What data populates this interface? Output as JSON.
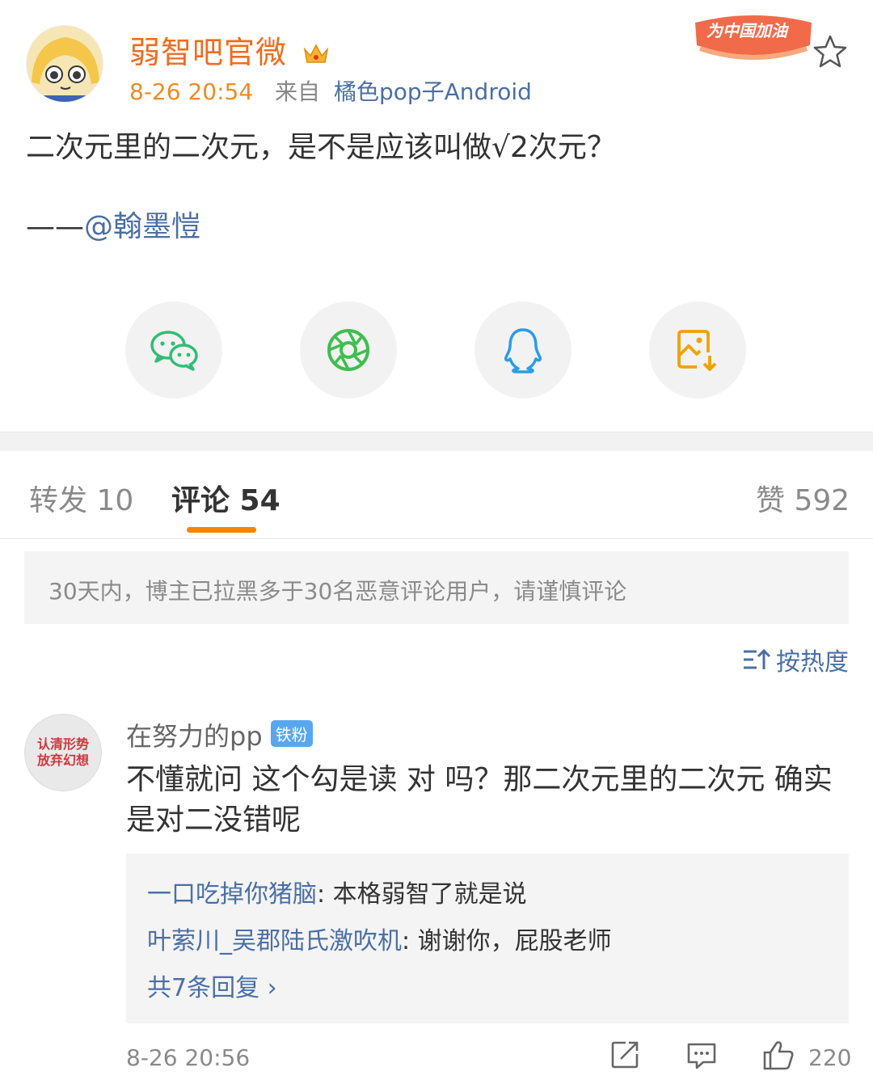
{
  "post": {
    "author": "弱智吧官微",
    "time": "8-26 20:54",
    "from_label": "来自",
    "device": "橘色pop子Android",
    "badge_text": "为中国加油",
    "text": "二次元里的二次元，是不是应该叫做√2次元？",
    "signature_prefix": "——",
    "signature_mention": "@翰墨愷"
  },
  "share": [
    "wechat-icon",
    "moments-icon",
    "qq-icon",
    "save-image-icon"
  ],
  "tabs": {
    "repost": "转发 10",
    "comment": "评论 54",
    "like": "赞 592"
  },
  "notice": "30天内，博主已拉黑多于30名恶意评论用户，请谨慎评论",
  "sort_label": "按热度",
  "comment": {
    "avatar_text_1": "认清形势",
    "avatar_text_2": "放弃幻想",
    "user": "在努力的pp",
    "tag": "铁粉",
    "text": "不懂就问 这个勾是读 对 吗？那二次元里的二次元 确实是对二没错呢",
    "replies": [
      {
        "name": "一口吃掉你猪脑",
        "text": ": 本格弱智了就是说"
      },
      {
        "name": "叶萦川_吴郡陆氏激吹机",
        "text": ": 谢谢你，屁股老师"
      }
    ],
    "more_replies": "共7条回复 ›",
    "time": "8-26 20:56",
    "likes": "220"
  },
  "colors": {
    "accent": "#ff8200",
    "author": "#f06c1e",
    "link": "#4a6fa5",
    "wechat": "#2fbe74",
    "moments": "#3fbe4f",
    "qq": "#2b9be9",
    "save": "#f2a100"
  }
}
